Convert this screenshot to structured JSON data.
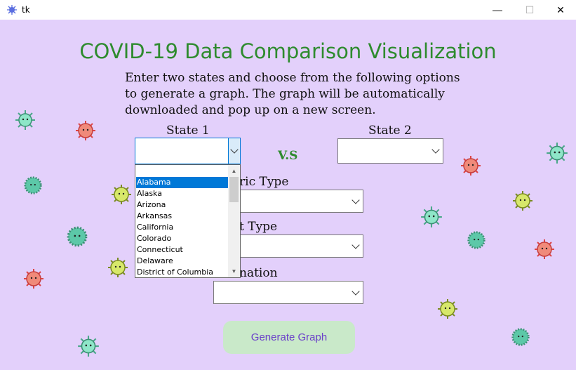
{
  "window": {
    "title": "tk",
    "minimize_glyph": "—",
    "maximize_glyph": "☐",
    "close_glyph": "✕",
    "icon": "feather-icon"
  },
  "heading": "COVID-19 Data Comparison Visualization",
  "intro_lines": [
    "Enter two states and choose from the following options",
    "to generate a graph. The graph will be automatically",
    "downloaded and pop up on a new screen."
  ],
  "state1": {
    "label": "State 1",
    "value": ""
  },
  "vs_label": "V.S",
  "state2": {
    "label": "State 2",
    "value": ""
  },
  "metric_type": {
    "label_visible": "ric Type",
    "value": ""
  },
  "chart_type": {
    "label_visible": "t Type",
    "value": ""
  },
  "destination": {
    "label_visible": "nation",
    "value": ""
  },
  "state_options": [
    "Alabama",
    "Alaska",
    "Arizona",
    "Arkansas",
    "California",
    "Colorado",
    "Connecticut",
    "Delaware",
    "District of Columbia"
  ],
  "selected_option": "Alabama",
  "generate_button": "Generate Graph",
  "colors": {
    "background": "#e3d0fb",
    "title_green": "#2e8b2e",
    "button_bg": "#c9e9c9",
    "button_text": "#6a3fc9",
    "selection": "#0078d7"
  }
}
